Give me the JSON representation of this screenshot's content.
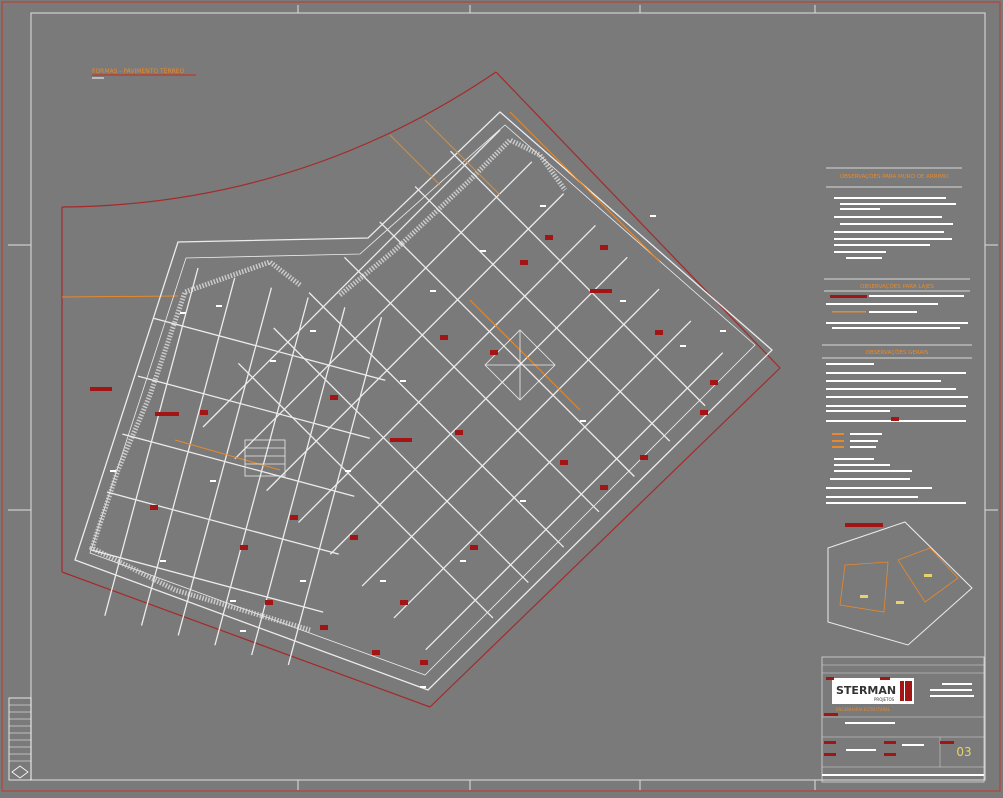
{
  "drawing": {
    "plan_title": "FORMAS - PAVIMENTO TÉRREO",
    "sheet_number": "03"
  },
  "notes": {
    "retaining_wall_title": "OBSERVAÇÕES PARA MURO DE ARRIMO",
    "slabs_title": "OBSERVAÇÕES PARA LAJES",
    "general_title": "OBSERVAÇÕES GERAIS"
  },
  "title_block": {
    "company": "STERMAN",
    "company_sub": "PROJETOS",
    "tagline": "ENGENHARIA  ESTRUTURAL"
  },
  "colors": {
    "background": "#7a7a7a",
    "frame": "#c0392b",
    "lines": "#ececec",
    "accent": "#e8892b",
    "label": "#a31515",
    "sheet_number": "#e8d36a"
  }
}
